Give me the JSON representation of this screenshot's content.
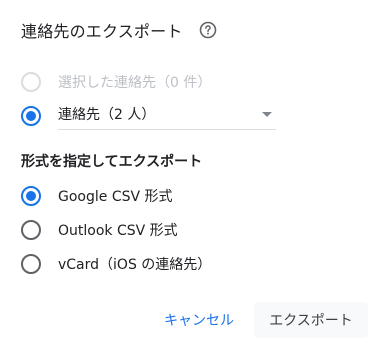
{
  "dialog": {
    "title": "連絡先のエクスポート",
    "help_icon": "help-circle-icon",
    "scope_options": [
      {
        "label": "選択した連絡先（0 件）",
        "checked": false,
        "disabled": true
      },
      {
        "label": "連絡先（2 人）",
        "checked": true,
        "disabled": false
      }
    ],
    "format_section_title": "形式を指定してエクスポート",
    "format_options": [
      {
        "label": "Google CSV 形式",
        "checked": true
      },
      {
        "label": "Outlook CSV 形式",
        "checked": false
      },
      {
        "label": "vCard（iOS の連絡先）",
        "checked": false
      }
    ],
    "buttons": {
      "cancel": "キャンセル",
      "export": "エクスポート"
    },
    "colors": {
      "accent": "#1a73e8",
      "text": "#202124",
      "disabled_text": "#bdc1c6"
    }
  }
}
